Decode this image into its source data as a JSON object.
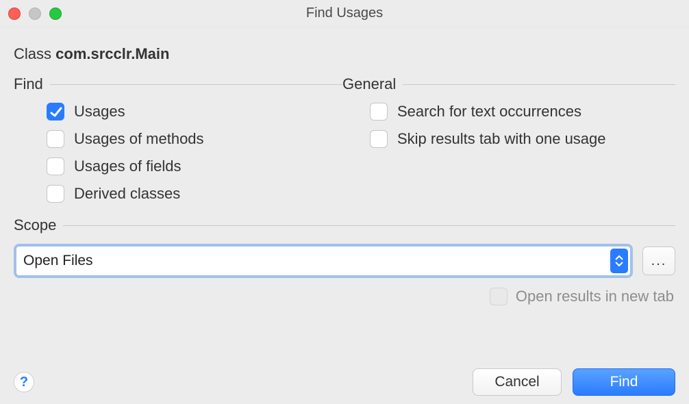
{
  "window": {
    "title": "Find Usages"
  },
  "header": {
    "kind": "Class",
    "fqn": "com.srcclr.Main"
  },
  "find": {
    "legend": "Find",
    "usages": "Usages",
    "usages_methods": "Usages of methods",
    "usages_fields": "Usages of fields",
    "derived_classes": "Derived classes"
  },
  "general": {
    "legend": "General",
    "search_text": "Search for text occurrences",
    "skip_one": "Skip results tab with one usage"
  },
  "scope": {
    "legend": "Scope",
    "selected": "Open Files",
    "more": "...",
    "open_new_tab": "Open results in new tab"
  },
  "footer": {
    "help": "?",
    "cancel": "Cancel",
    "find": "Find"
  },
  "checks": {
    "usages": true,
    "usages_methods": false,
    "usages_fields": false,
    "derived_classes": false,
    "search_text": false,
    "skip_one": false,
    "open_new_tab": false
  }
}
